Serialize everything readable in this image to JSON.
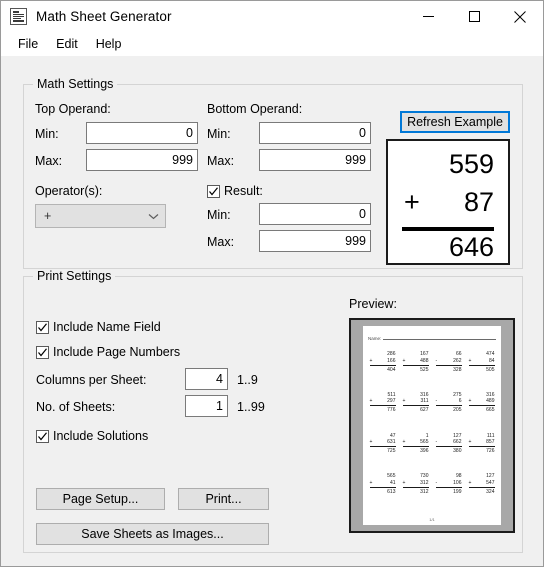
{
  "window": {
    "title": "Math Sheet Generator",
    "app_icon": "document-lines-icon",
    "controls": {
      "minimize": "minimize-icon",
      "maximize": "maximize-icon",
      "close": "close-icon"
    }
  },
  "menu": {
    "items": [
      "File",
      "Edit",
      "Help"
    ]
  },
  "math_settings": {
    "title": "Math Settings",
    "top_operand": {
      "label": "Top Operand:",
      "min_label": "Min:",
      "min_value": "0",
      "max_label": "Max:",
      "max_value": "999"
    },
    "bottom_operand": {
      "label": "Bottom Operand:",
      "min_label": "Min:",
      "min_value": "0",
      "max_label": "Max:",
      "max_value": "999"
    },
    "operators": {
      "label": "Operator(s):",
      "selected": "+",
      "options": [
        "+",
        "-",
        "*",
        "/"
      ]
    },
    "result": {
      "label": "Result:",
      "checked": true,
      "min_label": "Min:",
      "min_value": "0",
      "max_label": "Max:",
      "max_value": "999"
    },
    "refresh_button": "Refresh Example",
    "example": {
      "top": "559",
      "operator": "+",
      "bottom": "87",
      "result": "646"
    }
  },
  "print_settings": {
    "title": "Print Settings",
    "include_name_field": {
      "label": "Include Name Field",
      "checked": true
    },
    "include_page_numbers": {
      "label": "Include Page Numbers",
      "checked": true
    },
    "columns_per_sheet": {
      "label": "Columns per Sheet:",
      "value": "4",
      "hint": "1..9"
    },
    "no_of_sheets": {
      "label": "No. of Sheets:",
      "value": "1",
      "hint": "1..99"
    },
    "include_solutions": {
      "label": "Include Solutions",
      "checked": true
    },
    "page_setup_button": "Page Setup...",
    "print_button": "Print...",
    "save_images_button": "Save Sheets as Images...",
    "preview": {
      "label": "Preview:",
      "name_field": "Name:",
      "page_number": "1/1",
      "problems": [
        {
          "a": "286",
          "op": "+",
          "b": "166",
          "c": "404"
        },
        {
          "a": "167",
          "op": "+",
          "b": "488",
          "c": "525"
        },
        {
          "a": "66",
          "op": "-",
          "b": "262",
          "c": "328"
        },
        {
          "a": "474",
          "op": "+",
          "b": "84",
          "c": "505"
        },
        {
          "a": "511",
          "op": "+",
          "b": "297",
          "c": "776"
        },
        {
          "a": "316",
          "op": "+",
          "b": "311",
          "c": "627"
        },
        {
          "a": "275",
          "op": "-",
          "b": "6",
          "c": "205"
        },
        {
          "a": "316",
          "op": "+",
          "b": "489",
          "c": "665"
        },
        {
          "a": "47",
          "op": "+",
          "b": "631",
          "c": "725"
        },
        {
          "a": "1",
          "op": "+",
          "b": "565",
          "c": "396"
        },
        {
          "a": "127",
          "op": "-",
          "b": "662",
          "c": "380"
        },
        {
          "a": "111",
          "op": "+",
          "b": "857",
          "c": "726"
        },
        {
          "a": "565",
          "op": "+",
          "b": "41",
          "c": "613"
        },
        {
          "a": "730",
          "op": "+",
          "b": "312",
          "c": "312"
        },
        {
          "a": "98",
          "op": "-",
          "b": "106",
          "c": "199"
        },
        {
          "a": "127",
          "op": "+",
          "b": "547",
          "c": "324"
        }
      ]
    }
  },
  "colors": {
    "accent": "#0078d7",
    "window_bg": "#f0f0f0",
    "control_bg": "#e1e1e1",
    "field_bg": "#ffffff"
  }
}
